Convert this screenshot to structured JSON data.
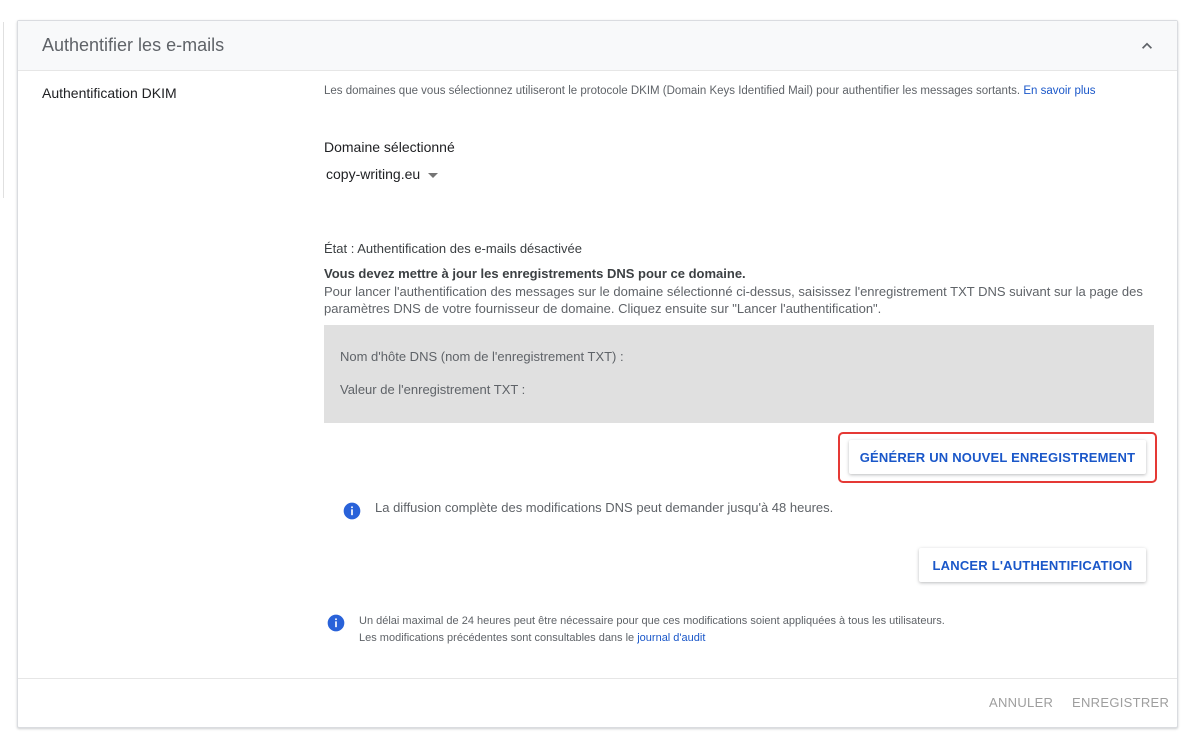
{
  "card": {
    "title": "Authentifier les e-mails"
  },
  "dkim": {
    "section_label": "Authentification DKIM",
    "description": "Les domaines que vous sélectionnez utiliseront le protocole DKIM (Domain Keys Identified Mail) pour authentifier les messages sortants.",
    "learn_more": "En savoir plus",
    "domain_label": "Domaine sélectionné",
    "domain_value": "copy-writing.eu",
    "status": "État : Authentification des e-mails désactivée",
    "notice_title": "Vous devez mettre à jour les enregistrements DNS pour ce domaine.",
    "notice_body": "Pour lancer l'authentification des messages sur le domaine sélectionné ci-dessus, saisissez l'enregistrement TXT DNS suivant sur la page des paramètres DNS de votre fournisseur de domaine. Cliquez ensuite sur \"Lancer l'authentification\".",
    "dns_host_label": "Nom d'hôte DNS (nom de l'enregistrement TXT) :",
    "txt_value_label": "Valeur de l'enregistrement TXT :",
    "generate_button": "GÉNÉRER UN NOUVEL ENREGISTREMENT",
    "propagation_info": "La diffusion complète des modifications DNS peut demander jusqu'à 48 heures.",
    "launch_button": "LANCER L'AUTHENTIFICATION",
    "note_line1": "Un délai maximal de 24 heures peut être nécessaire pour que ces modifications soient appliquées à tous les utilisateurs.",
    "note_line2": "Les modifications précédentes sont consultables dans le",
    "audit_link": "journal d'audit"
  },
  "footer": {
    "cancel": "ANNULER",
    "save": "ENREGISTRER"
  },
  "colors": {
    "accent": "#1a57c9",
    "info_icon": "#2962d9",
    "highlight": "#e53935",
    "arrow": "#e02020"
  },
  "icons": {
    "collapse": "chevron-up-icon",
    "info": "info-icon",
    "dropdown": "caret-down-icon",
    "annotation": "red-arrow-icon"
  }
}
